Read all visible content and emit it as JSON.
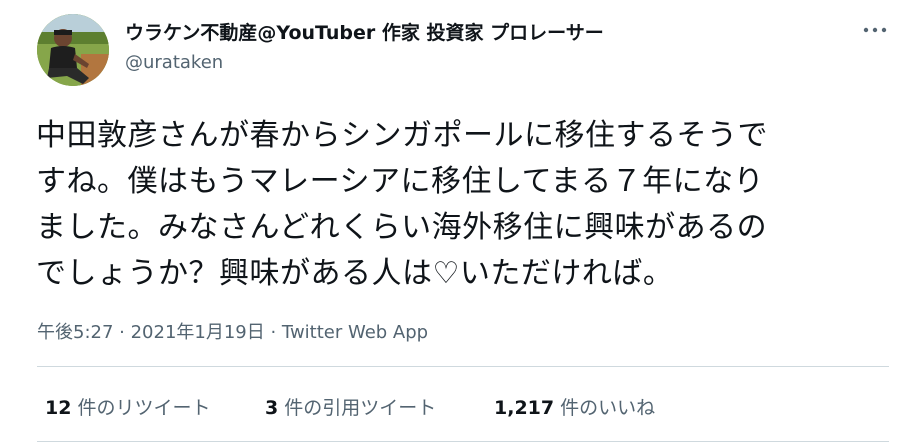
{
  "author": {
    "display_name": "ウラケン不動産@YouTuber 作家 投資家 プロレーサー",
    "handle": "@urataken"
  },
  "tweet": {
    "lines": [
      "中田敦彦さんが春からシンガポールに移住するそうで",
      "すね。僕はもうマレーシアに移住してまる７年になり",
      "ました。みなさんどれくらい海外移住に興味があるの",
      "でしょうか？興味がある人は♡いただければ。"
    ]
  },
  "meta": {
    "timestamp": "午後5:27 · 2021年1月19日 · ",
    "source": "Twitter Web App"
  },
  "stats": {
    "retweets": {
      "count": "12",
      "label": " 件のリツイート"
    },
    "quotes": {
      "count": "3",
      "label": " 件の引用ツイート"
    },
    "likes": {
      "count": "1,217",
      "label": " 件のいいね"
    }
  },
  "icons": {
    "more": "more-horizontal-icon",
    "avatar": "profile-photo"
  },
  "colors": {
    "text": "#0f1419",
    "secondary": "#536471",
    "divider": "#cfd9de"
  }
}
